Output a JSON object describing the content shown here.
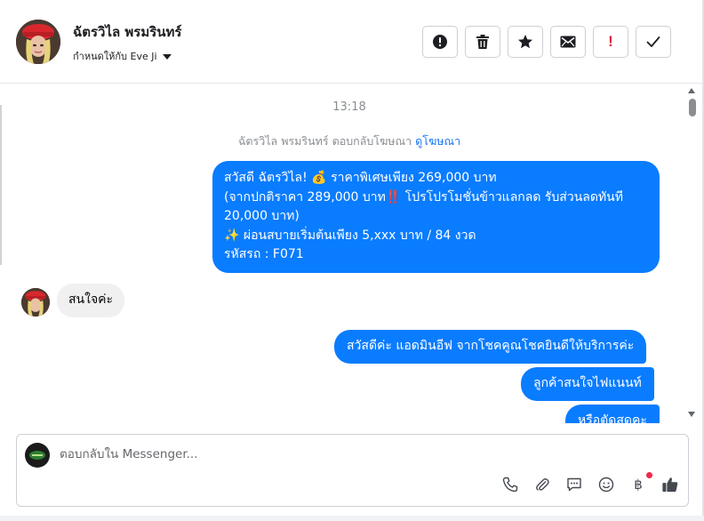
{
  "header": {
    "contact_name": "ฉัตรวิไล พรมรินทร์",
    "assign_label": "กำหนดให้กับ Eve Ji",
    "actions": [
      {
        "name": "report-icon"
      },
      {
        "name": "trash-icon"
      },
      {
        "name": "star-icon"
      },
      {
        "name": "mail-icon"
      },
      {
        "name": "exclamation-icon",
        "label": "!",
        "color": "#e41e3f"
      },
      {
        "name": "check-icon"
      }
    ]
  },
  "thread": {
    "timestamp": "13:18",
    "reply_note": "ฉัตรวิไล พรมรินทร์ ตอบกลับโฆษณา",
    "reply_link": "ดูโฆษณา",
    "ad_message": {
      "line1": "สวัสดี ฉัตรวิไล! 💰 ราคาพิเศษเพียง 269,000 บาท",
      "line2": "(จากปกติราคา 289,000 บาท‼️ โปรโปรโมชั่นข้าวแลกลด รับส่วนลดทันที",
      "line3": "20,000 บาท)",
      "line4": "✨ ผ่อนสบายเริ่มต้นเพียง 5,xxx บาท / 84 งวด",
      "line5": " รหัสรถ : F071"
    },
    "incoming_message": "สนใจค่ะ",
    "outgoing_messages": [
      "สวัสดีค่ะ แอดมินอีฟ จากโชคคูณโชคยินดีให้บริการค่ะ",
      "ลูกค้าสนใจไฟแนนท์",
      "หรือตัดสดคะ"
    ]
  },
  "composer": {
    "placeholder": "ตอบกลับใน Messenger...",
    "tools": [
      "phone-icon",
      "paperclip-icon",
      "chat-icon",
      "emoji-icon",
      "baht-icon",
      "thumbs-up-icon"
    ],
    "baht_symbol": "฿"
  },
  "colors": {
    "outgoing_bubble": "#0a7cff",
    "incoming_bubble": "#f0f0f0",
    "link": "#1877f2"
  }
}
